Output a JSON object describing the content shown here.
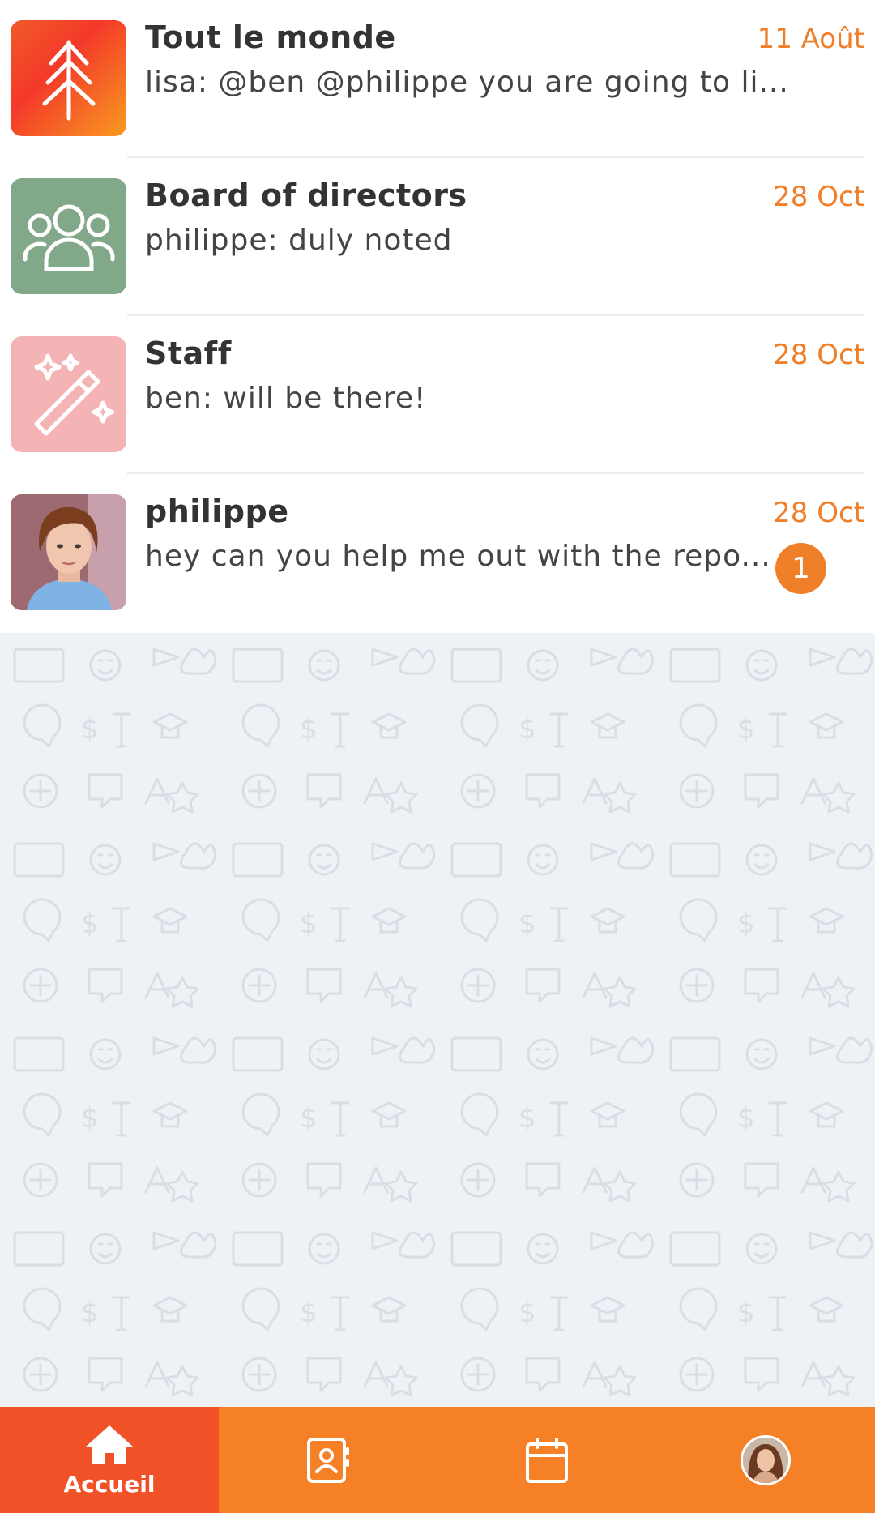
{
  "conversations": [
    {
      "title": "Tout le monde",
      "preview": "lisa: @ben @philippe you are going to li...",
      "date": "11 Août",
      "icon": "tree-icon"
    },
    {
      "title": "Board of directors",
      "preview": "philippe: duly noted",
      "date": "28 Oct",
      "icon": "group-icon"
    },
    {
      "title": "Staff",
      "preview": "ben: will be there!",
      "date": "28 Oct",
      "icon": "magic-wand-icon"
    },
    {
      "title": "philippe",
      "preview": "hey can you help me out with the repo...",
      "date": "28 Oct",
      "unread": "1",
      "icon": "user-photo"
    }
  ],
  "tabs": [
    {
      "label": "Accueil",
      "icon": "home-icon",
      "active": true
    },
    {
      "label": "",
      "icon": "contacts-icon"
    },
    {
      "label": "",
      "icon": "calendar-icon"
    },
    {
      "label": "",
      "icon": "profile-avatar"
    }
  ],
  "colors": {
    "accent": "#f07f2a",
    "tabbar": "#f58026",
    "tab_active": "#f05126",
    "board_avatar": "#81a888",
    "staff_avatar": "#f4b3b5"
  }
}
